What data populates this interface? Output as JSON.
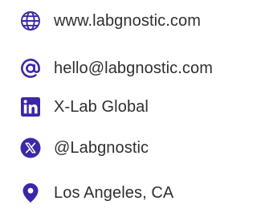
{
  "accent_color": "#3b27a8",
  "text_color": "#2f2f33",
  "contacts": [
    {
      "icon": "globe-icon",
      "label": "www.labgnostic.com"
    },
    {
      "icon": "at-sign-icon",
      "label": "hello@labgnostic.com"
    },
    {
      "icon": "linkedin-icon",
      "label": "X-Lab Global"
    },
    {
      "icon": "x-twitter-icon",
      "label": "@Labgnostic"
    },
    {
      "icon": "map-pin-icon",
      "label": "Los Angeles, CA"
    }
  ]
}
